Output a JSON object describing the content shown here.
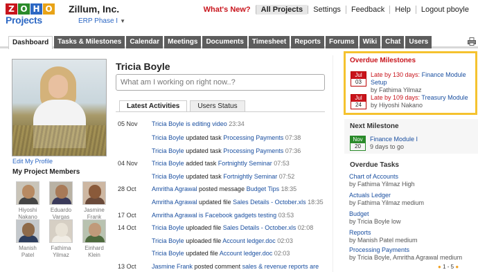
{
  "brand": {
    "logo_letters": [
      "Z",
      "O",
      "H",
      "O"
    ],
    "logo_colors": [
      "#c8141c",
      "#2a8a2a",
      "#2d68c4",
      "#e8a317"
    ],
    "product": "Projects"
  },
  "company": "Zillum, Inc.",
  "project": "ERP Phase I",
  "top_links": [
    "What's New?",
    "All Projects",
    "Settings",
    "Feedback",
    "Help",
    "Logout pboyle"
  ],
  "tabs": [
    "Dashboard",
    "Tasks & Milestones",
    "Calendar",
    "Meetings",
    "Documents",
    "Timesheet",
    "Reports",
    "Forums",
    "Wiki",
    "Chat",
    "Users"
  ],
  "profile": {
    "edit_link": "Edit My Profile",
    "members_heading": "My Project Members",
    "user_name": "Tricia Boyle",
    "status_placeholder": "What am I working on right now..?"
  },
  "members": [
    {
      "first": "Hiyoshi",
      "last": "Nakano"
    },
    {
      "first": "Eduardo",
      "last": "Vargas"
    },
    {
      "first": "Jasmine",
      "last": "Frank"
    },
    {
      "first": "Manish",
      "last": "Patel"
    },
    {
      "first": "Fathima",
      "last": "Yilmaz"
    },
    {
      "first": "Einhard",
      "last": "Klein"
    }
  ],
  "subtabs": [
    "Latest Activities",
    "Users Status"
  ],
  "activities": [
    {
      "date": "05 Nov",
      "user": "Tricia Boyle",
      "action": " is editing video ",
      "object": "",
      "time": "23:34"
    },
    {
      "date": "",
      "user": "Tricia Boyle",
      "action": " updated task ",
      "object": "Processing Payments",
      "time": " 07:38"
    },
    {
      "date": "",
      "user": "Tricia Boyle",
      "action": " updated task ",
      "object": "Processing Payments",
      "time": " 07:36"
    },
    {
      "date": "04 Nov",
      "user": "Tricia Boyle",
      "action": " added task ",
      "object": "Fortnightly Seminar",
      "time": " 07:53"
    },
    {
      "date": "",
      "user": "Tricia Boyle",
      "action": " updated task ",
      "object": "Fortnightly Seminar",
      "time": " 07:52"
    },
    {
      "date": "28 Oct",
      "user": "Amritha Agrawal",
      "action": " posted  message ",
      "object": "Budget Tips",
      "time": " 18:35"
    },
    {
      "date": "",
      "user": "Amritha Agrawal",
      "action": " updated file ",
      "object": "Sales Details - October.xls",
      "time": " 18:35"
    },
    {
      "date": "17 Oct",
      "user": "Amritha Agrawal",
      "action": " is Facebook gadgets testing ",
      "object": "",
      "time": "03:53"
    },
    {
      "date": "14 Oct",
      "user": "Tricia Boyle",
      "action": " uploaded file ",
      "object": "Sales Details - October.xls",
      "time": " 02:08"
    },
    {
      "date": "",
      "user": "Tricia Boyle",
      "action": " uploaded file ",
      "object": "Account ledger.doc",
      "time": " 02:03"
    },
    {
      "date": "",
      "user": "Tricia Boyle",
      "action": " updated file ",
      "object": "Account ledger.doc",
      "time": " 02:03"
    },
    {
      "date": "13 Oct",
      "user": "Jasmine Frank",
      "action": " posted comment ",
      "object": "sales & revenue reports are",
      "time": ""
    }
  ],
  "overdue_milestones": {
    "heading": "Overdue Milestones",
    "items": [
      {
        "month": "Jul",
        "day": "03",
        "late": "Late by 130 days:",
        "name": "Finance Module Setup",
        "by": "by Fathima Yilmaz"
      },
      {
        "month": "Jul",
        "day": "24",
        "late": "Late by 109 days:",
        "name": "Treasury Module",
        "by": "by Hiyoshi Nakano"
      }
    ]
  },
  "next_milestone": {
    "heading": "Next Milestone",
    "month": "Nov",
    "day": "20",
    "name": "Finance Module I",
    "due": "9 days to go"
  },
  "overdue_tasks": {
    "heading": "Overdue Tasks",
    "items": [
      {
        "name": "Chart of Accounts",
        "by": "by Fathima Yilmaz  High"
      },
      {
        "name": "Actuals Ledger",
        "by": "by Fathima Yilmaz  medium"
      },
      {
        "name": "Budget",
        "by": "by Tricia Boyle  low"
      },
      {
        "name": "Reports",
        "by": "by Manish Patel  medium"
      },
      {
        "name": "Processing Payments",
        "by": "by Tricia Boyle, Amritha Agrawal  medium"
      }
    ],
    "pager": "1 - 5"
  }
}
